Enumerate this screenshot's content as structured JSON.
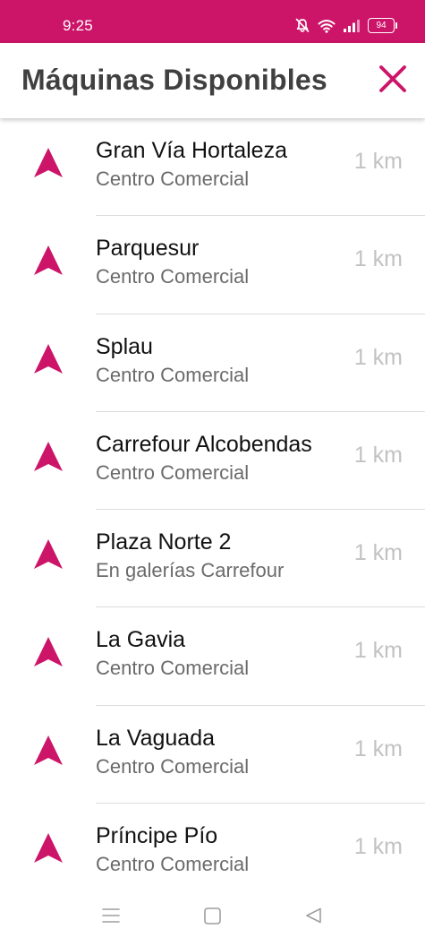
{
  "status_bar": {
    "time": "9:25",
    "battery": "94",
    "icons": [
      "bell-off-icon",
      "wifi-icon",
      "signal-icon",
      "battery-icon"
    ]
  },
  "header": {
    "title": "Máquinas Disponibles",
    "close_icon": "close-icon"
  },
  "colors": {
    "accent": "#cc1569",
    "title": "#404040",
    "subtitle": "#6b6b6b",
    "distance": "#c2c2c2",
    "divider": "#dcdcdc"
  },
  "machines": [
    {
      "name": "Gran Vía Hortaleza",
      "subtitle": "Centro Comercial",
      "distance": "1 km",
      "icon": "navigation-arrow-icon"
    },
    {
      "name": "Parquesur",
      "subtitle": "Centro Comercial",
      "distance": "1 km",
      "icon": "navigation-arrow-icon"
    },
    {
      "name": "Splau",
      "subtitle": "Centro Comercial",
      "distance": "1 km",
      "icon": "navigation-arrow-icon"
    },
    {
      "name": "Carrefour Alcobendas",
      "subtitle": "Centro Comercial",
      "distance": "1 km",
      "icon": "navigation-arrow-icon"
    },
    {
      "name": "Plaza Norte 2",
      "subtitle": "En galerías Carrefour",
      "distance": "1 km",
      "icon": "navigation-arrow-icon"
    },
    {
      "name": "La Gavia",
      "subtitle": "Centro Comercial",
      "distance": "1 km",
      "icon": "navigation-arrow-icon"
    },
    {
      "name": "La Vaguada",
      "subtitle": "Centro Comercial",
      "distance": "1 km",
      "icon": "navigation-arrow-icon"
    },
    {
      "name": "Príncipe Pío",
      "subtitle": "Centro Comercial",
      "distance": "1 km",
      "icon": "navigation-arrow-icon"
    }
  ],
  "nav_bar": {
    "icons": [
      "menu-icon",
      "home-icon",
      "back-icon"
    ]
  }
}
